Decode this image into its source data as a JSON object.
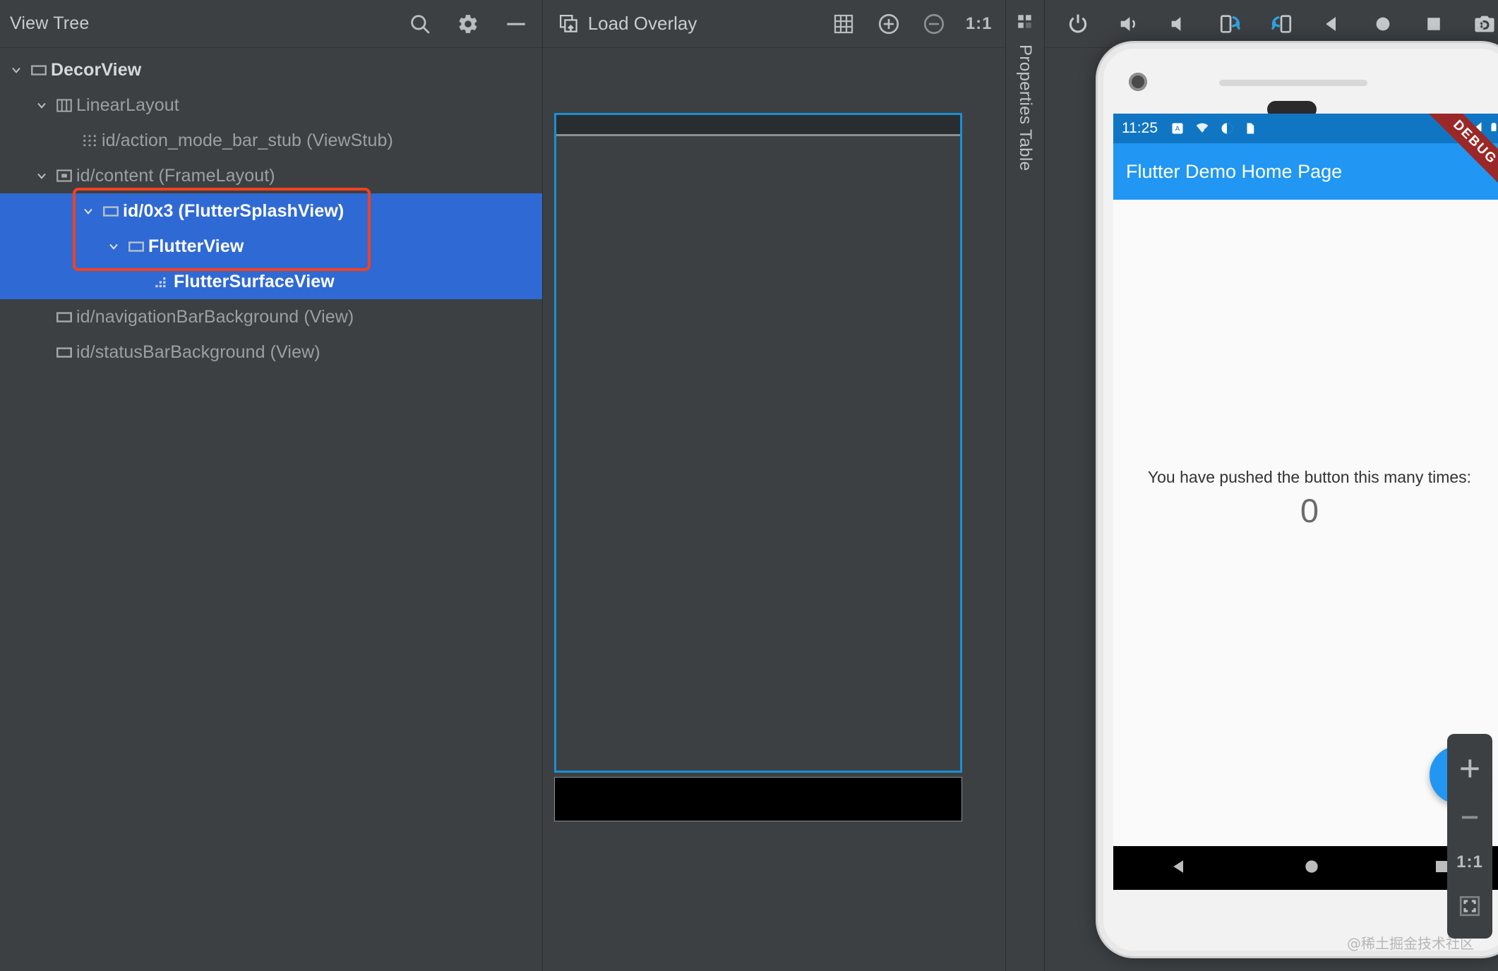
{
  "left_panel": {
    "title": "View Tree",
    "tools": [
      {
        "name": "search-icon",
        "label": "Search"
      },
      {
        "name": "gear-icon",
        "label": "Settings"
      },
      {
        "name": "minus-icon",
        "label": "Collapse"
      }
    ],
    "tree": [
      {
        "label": "DecorView",
        "depth": 0,
        "icon": "view-rect-icon",
        "twist": "down",
        "selected": false,
        "strong": true
      },
      {
        "label": "LinearLayout",
        "depth": 1,
        "icon": "columns-icon",
        "twist": "down",
        "selected": false,
        "strong": false
      },
      {
        "label": "id/action_mode_bar_stub (ViewStub)",
        "depth": 2,
        "icon": "dots-grid-icon",
        "twist": "none",
        "selected": false,
        "strong": false
      },
      {
        "label": "id/content (FrameLayout)",
        "depth": 2,
        "icon": "frame-icon",
        "twist": "down",
        "selected": false,
        "strong": false
      },
      {
        "label": "id/0x3 (FlutterSplashView)",
        "depth": 3,
        "icon": "view-rect-icon",
        "twist": "down",
        "selected": true,
        "strong": true
      },
      {
        "label": "FlutterView",
        "depth": 4,
        "icon": "view-rect-icon",
        "twist": "down",
        "selected": true,
        "strong": true
      },
      {
        "label": "FlutterSurfaceView",
        "depth": 5,
        "icon": "surface-dots-icon",
        "twist": "none",
        "selected": true,
        "strong": true
      },
      {
        "label": "id/navigationBarBackground (View)",
        "depth": 1,
        "icon": "view-rect-icon",
        "twist": "none",
        "selected": false,
        "strong": false
      },
      {
        "label": "id/statusBarBackground (View)",
        "depth": 1,
        "icon": "view-rect-icon",
        "twist": "none",
        "selected": false,
        "strong": false
      }
    ],
    "selection_highlight_color": "#2f69d4",
    "selection_box_color": "#f4411e"
  },
  "middle_panel": {
    "load_overlay_label": "Load Overlay",
    "load_overlay_icon": "load-overlay-icon",
    "tools": [
      {
        "name": "grid-icon",
        "label": "Show Grid"
      },
      {
        "name": "zoom-in-icon",
        "label": "Zoom In"
      },
      {
        "name": "zoom-out-icon",
        "label": "Zoom Out"
      },
      {
        "name": "ratio-1-1",
        "label": "1:1"
      }
    ],
    "preview_outline_color": "#1a8fd6"
  },
  "properties_strip": {
    "label": "Properties Table",
    "icon": "properties-table-icon"
  },
  "right_panel": {
    "tools": [
      {
        "name": "power-icon",
        "label": "Power"
      },
      {
        "name": "volume-up-icon",
        "label": "Volume Up"
      },
      {
        "name": "volume-down-icon",
        "label": "Volume Down"
      },
      {
        "name": "rotate-left-icon",
        "label": "Rotate Left"
      },
      {
        "name": "rotate-right-icon",
        "label": "Rotate Right"
      },
      {
        "name": "back-icon",
        "label": "Back"
      },
      {
        "name": "home-icon",
        "label": "Home"
      },
      {
        "name": "overview-icon",
        "label": "Overview"
      },
      {
        "name": "screenshot-icon",
        "label": "Screenshot"
      }
    ],
    "more_label": "»",
    "accent_color": "#2ea1e0"
  },
  "device": {
    "status_bar": {
      "time": "11:25",
      "icons": [
        "alarm-icon",
        "wifi-question-icon",
        "dnd-icon",
        "sdcard-icon"
      ],
      "right_icons": [
        "wifi-off-icon",
        "signal-off-icon",
        "battery-icon"
      ],
      "background_color": "#1076c4"
    },
    "app_bar": {
      "title": "Flutter Demo Home Page",
      "background_color": "#2196f3"
    },
    "debug_ribbon": "DEBUG",
    "content": {
      "counter_text": "You have pushed the button this many times:",
      "counter_value": "0"
    },
    "fab": {
      "icon": "plus-icon",
      "label": "+",
      "color": "#2196f3"
    },
    "nav_bar": [
      "back-triangle-icon",
      "home-circle-icon",
      "overview-square-icon"
    ]
  },
  "zoom_control": {
    "items": [
      {
        "name": "zoom-in-icon",
        "label": "+"
      },
      {
        "name": "zoom-out-icon",
        "label": "−"
      },
      {
        "name": "ratio-1-1-label",
        "label": "1:1"
      },
      {
        "name": "fit-screen-icon",
        "label": "Fit"
      }
    ]
  },
  "watermark": "@稀土掘金技术社区"
}
